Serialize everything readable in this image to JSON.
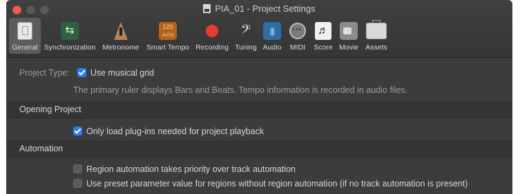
{
  "window": {
    "title": "PIA_01 - Project Settings",
    "traffic_lights": [
      "close",
      "minimize",
      "zoom"
    ]
  },
  "toolbar": {
    "tabs": [
      {
        "label": "General",
        "icon": "general-icon",
        "selected": true
      },
      {
        "label": "Synchronization",
        "icon": "sync-arrows-icon"
      },
      {
        "label": "Metronome",
        "icon": "metronome-icon"
      },
      {
        "label": "Smart Tempo",
        "icon": "smart-tempo-icon",
        "icon_text": "120",
        "icon_subtext": "AUTO"
      },
      {
        "label": "Recording",
        "icon": "record-icon"
      },
      {
        "label": "Tuning",
        "icon": "tuning-fork-icon"
      },
      {
        "label": "Audio",
        "icon": "audio-waveform-icon"
      },
      {
        "label": "MIDI",
        "icon": "midi-connector-icon"
      },
      {
        "label": "Score",
        "icon": "score-note-icon"
      },
      {
        "label": "Movie",
        "icon": "movie-camera-icon"
      },
      {
        "label": "Assets",
        "icon": "briefcase-icon"
      }
    ]
  },
  "general": {
    "project_type": {
      "label": "Project Type:",
      "checkbox_label": "Use musical grid",
      "checked": true,
      "description": "The primary ruler displays Bars and Beats. Tempo information is recorded in audio files."
    },
    "opening_project": {
      "header": "Opening Project",
      "checkbox_label": "Only load plug-ins needed for project playback",
      "checked": true
    },
    "automation": {
      "header": "Automation",
      "options": [
        {
          "label": "Region automation takes priority over track automation",
          "checked": false
        },
        {
          "label": "Use preset parameter value for regions without region automation (if no track automation is present)",
          "checked": false
        }
      ]
    }
  },
  "colors": {
    "window_bg": "#3c3c3c",
    "accent_checkbox": "#2b7ef6",
    "close_button": "#ee5e57"
  }
}
